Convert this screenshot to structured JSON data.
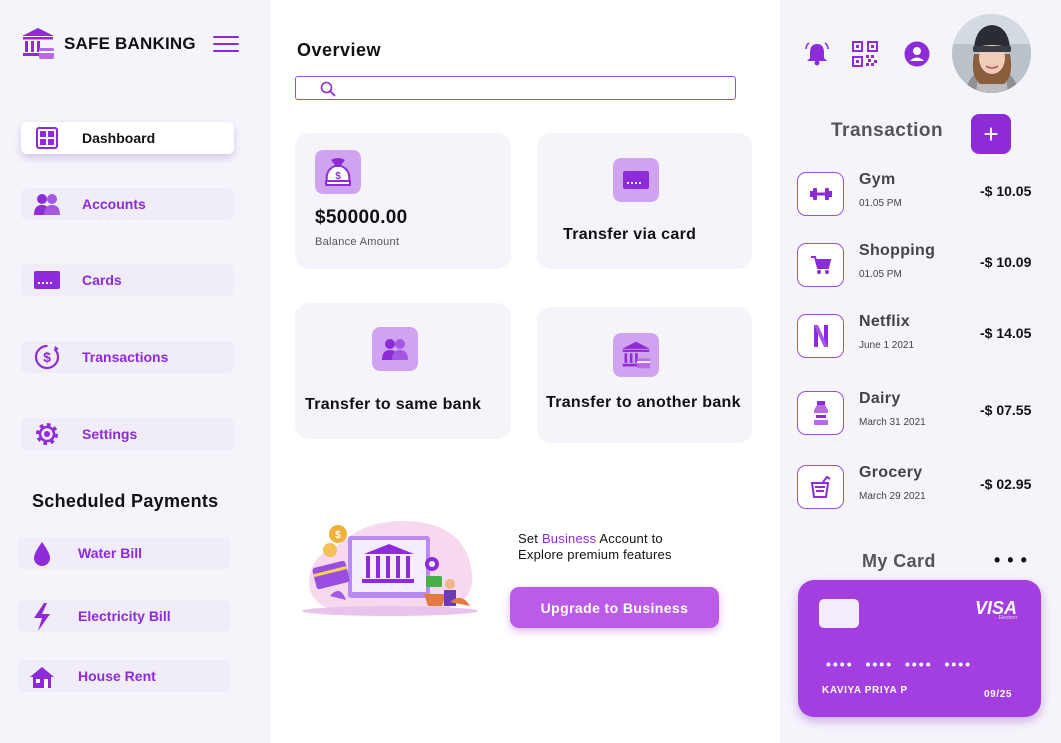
{
  "brand": {
    "name": "SAFE BANKING",
    "logo_icon": "bank-icon"
  },
  "nav": [
    {
      "label": "Dashboard",
      "icon": "dashboard-icon",
      "active": true
    },
    {
      "label": "Accounts",
      "icon": "users-icon"
    },
    {
      "label": "Cards",
      "icon": "card-icon"
    },
    {
      "label": "Transactions",
      "icon": "dollar-cycle-icon"
    },
    {
      "label": "Settings",
      "icon": "gear-icon"
    }
  ],
  "scheduled": {
    "title": "Scheduled Payments",
    "items": [
      {
        "label": "Water Bill",
        "icon": "water-drop-icon"
      },
      {
        "label": "Electricity Bill",
        "icon": "lightning-icon"
      },
      {
        "label": "House Rent",
        "icon": "house-icon"
      }
    ]
  },
  "main": {
    "title": "Overview",
    "search_placeholder": "",
    "tiles": [
      {
        "amount": "$50000.00",
        "sub": "Balance Amount",
        "icon": "money-bag-icon"
      },
      {
        "label": "Transfer via card",
        "icon": "card-icon"
      },
      {
        "label": "Transfer to same bank",
        "icon": "users-icon"
      },
      {
        "label": "Transfer to another bank",
        "icon": "bank-icon"
      }
    ],
    "promo": {
      "line1_pre": "Set ",
      "line1_highlight": "Business",
      "line1_post": " Account to",
      "line2": "Explore premium features",
      "button": "Upgrade to Business"
    }
  },
  "right": {
    "top_icons": [
      "bell-icon",
      "qr-code-icon",
      "user-circle-icon"
    ],
    "transaction_title": "Transaction",
    "add_label": "+",
    "transactions": [
      {
        "name": "Gym",
        "date": "01.05 PM",
        "amount": "-$ 10.05",
        "icon": "dumbbell-icon"
      },
      {
        "name": "Shopping",
        "date": "01.05 PM",
        "amount": "-$ 10.09",
        "icon": "cart-icon"
      },
      {
        "name": "Netflix",
        "date": "June 1 2021",
        "amount": "-$ 14.05",
        "icon": "netflix-icon"
      },
      {
        "name": "Dairy",
        "date": "March 31 2021",
        "amount": "-$ 07.55",
        "icon": "milk-bottle-icon"
      },
      {
        "name": "Grocery",
        "date": "March 29 2021",
        "amount": "-$ 02.95",
        "icon": "grocery-bag-icon"
      }
    ],
    "my_card": {
      "title": "My Card",
      "more": "• • •",
      "brand": "VISA",
      "brand_sub": "Electron",
      "number": "•••• •••• •••• ••••",
      "holder": "KAVIYA PRIYA P",
      "expiry": "09/25"
    }
  },
  "colors": {
    "accent": "#8e2bd8",
    "tile_bg": "#f6f4fb",
    "icon_bg": "#cfa3f0",
    "card": "#a33ee0",
    "button": "#bb5ce8"
  }
}
